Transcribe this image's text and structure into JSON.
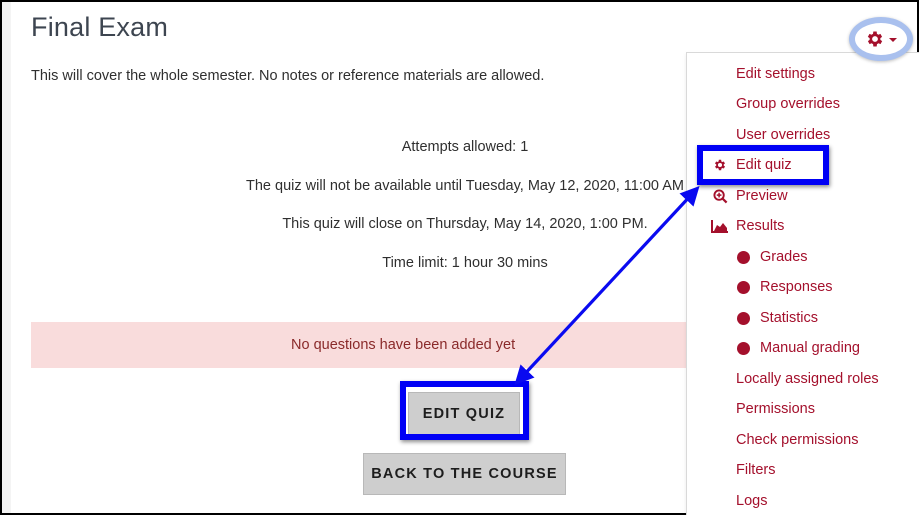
{
  "page": {
    "title": "Final Exam",
    "intro": "This will cover the whole semester. No notes or reference materials are allowed.",
    "info": [
      "Attempts allowed: 1",
      "The quiz will not be available until Tuesday, May 12, 2020, 11:00 AM",
      "This quiz will close on Thursday, May 14, 2020, 1:00 PM.",
      "Time limit: 1 hour 30 mins"
    ],
    "alert": "No questions have been added yet",
    "buttons": {
      "edit_quiz": "EDIT QUIZ",
      "back": "BACK TO THE COURSE"
    }
  },
  "actions_menu": {
    "trigger_icon": "gear-icon",
    "items": [
      {
        "label": "Edit settings",
        "icon": null
      },
      {
        "label": "Group overrides",
        "icon": null
      },
      {
        "label": "User overrides",
        "icon": null
      },
      {
        "label": "Edit quiz",
        "icon": "gear-icon"
      },
      {
        "label": "Preview",
        "icon": "zoom-in-icon"
      },
      {
        "label": "Results",
        "icon": "area-chart-icon"
      },
      {
        "label": "Grades",
        "icon": "bullet-icon"
      },
      {
        "label": "Responses",
        "icon": "bullet-icon"
      },
      {
        "label": "Statistics",
        "icon": "bullet-icon"
      },
      {
        "label": "Manual grading",
        "icon": "bullet-icon"
      },
      {
        "label": "Locally assigned roles",
        "icon": null
      },
      {
        "label": "Permissions",
        "icon": null
      },
      {
        "label": "Check permissions",
        "icon": null
      },
      {
        "label": "Filters",
        "icon": null
      },
      {
        "label": "Logs",
        "icon": null
      }
    ]
  },
  "colors": {
    "accent": "#a4102c",
    "highlight": "#0000f5",
    "alert_bg": "#f9dcdc",
    "alert_text": "#8a2a2a",
    "ring": "#a9c0ee"
  }
}
